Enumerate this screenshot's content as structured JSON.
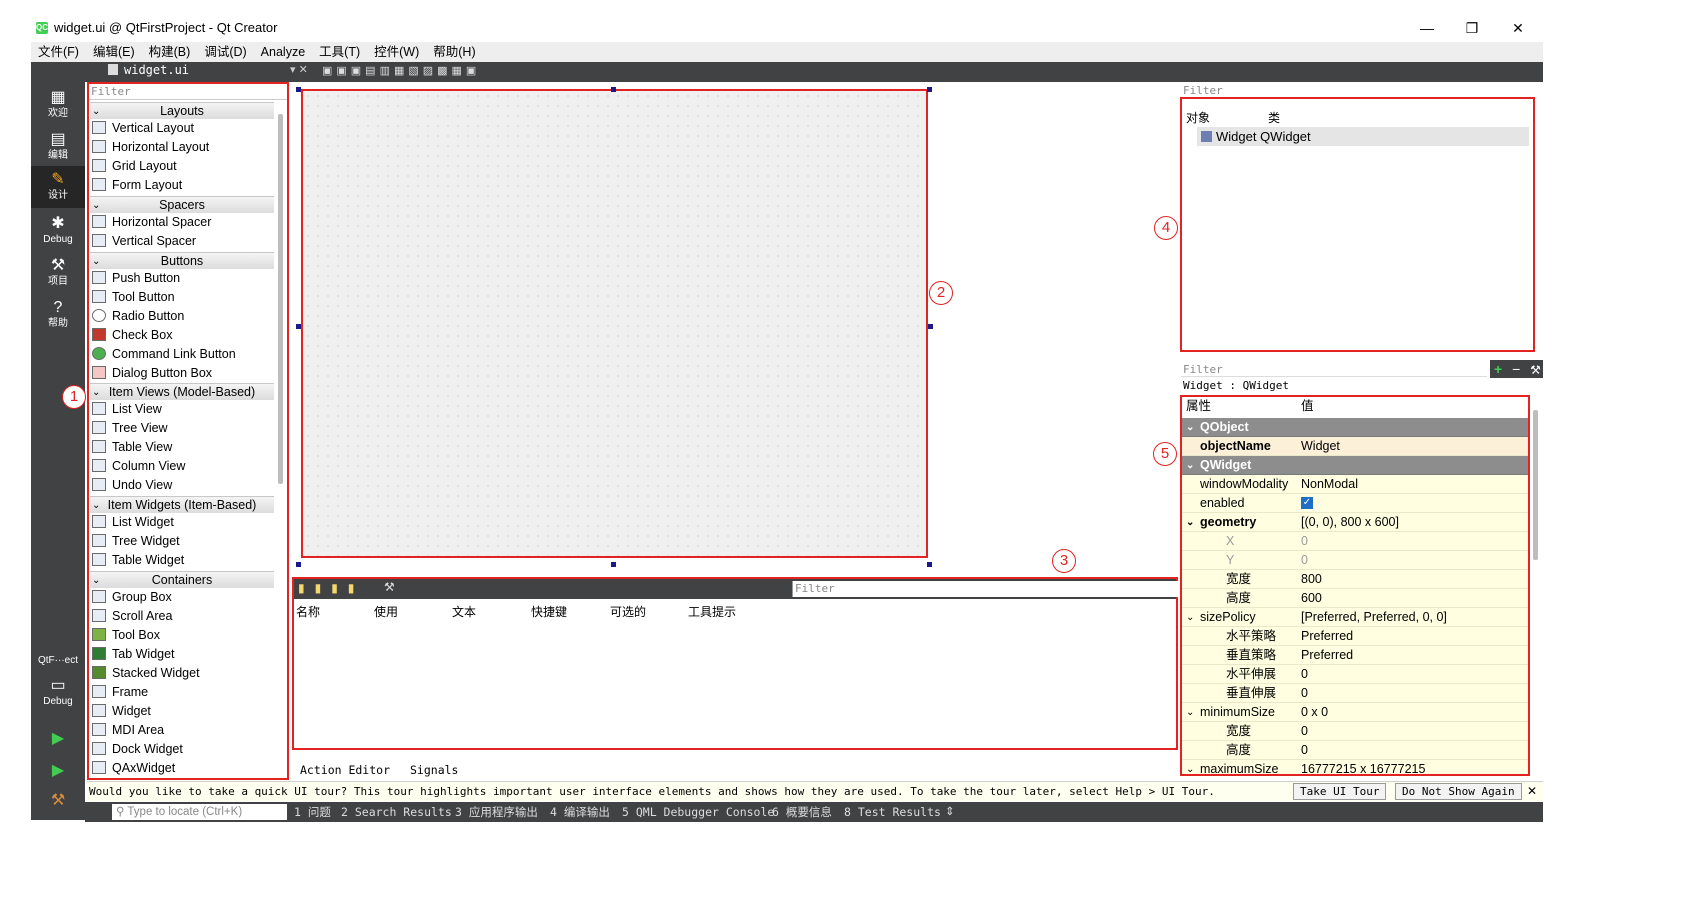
{
  "window": {
    "icon_text": "QC",
    "title": "widget.ui @ QtFirstProject - Qt Creator",
    "minimize": "—",
    "maximize": "❐",
    "close": "✕"
  },
  "menu": [
    "文件(F)",
    "编辑(E)",
    "构建(B)",
    "调试(D)",
    "Analyze",
    "工具(T)",
    "控件(W)",
    "帮助(H)"
  ],
  "modes": [
    {
      "label": "欢迎",
      "icon": "grid-icon"
    },
    {
      "label": "编辑",
      "icon": "document-icon"
    },
    {
      "label": "设计",
      "icon": "pencil-icon"
    },
    {
      "label": "Debug",
      "icon": "bug-icon"
    },
    {
      "label": "项目",
      "icon": "wrench-icon"
    },
    {
      "label": "帮助",
      "icon": "help-icon"
    }
  ],
  "kit": {
    "project": "QtF···ect",
    "config": "Debug"
  },
  "document_tab": "widget.ui",
  "widget_box": {
    "filter_placeholder": "Filter",
    "categories": {
      "layouts": "Layouts",
      "spacers": "Spacers",
      "buttons": "Buttons",
      "item_views": "Item Views (Model-Based)",
      "item_widgets": "Item Widgets (Item-Based)",
      "containers": "Containers"
    },
    "items": {
      "vertical_layout": "Vertical Layout",
      "horizontal_layout": "Horizontal Layout",
      "grid_layout": "Grid Layout",
      "form_layout": "Form Layout",
      "horizontal_spacer": "Horizontal Spacer",
      "vertical_spacer": "Vertical Spacer",
      "push_button": "Push Button",
      "tool_button": "Tool Button",
      "radio_button": "Radio Button",
      "check_box": "Check Box",
      "command_link_button": "Command Link Button",
      "dialog_button_box": "Dialog Button Box",
      "list_view": "List View",
      "tree_view": "Tree View",
      "table_view": "Table View",
      "column_view": "Column View",
      "undo_view": "Undo View",
      "list_widget": "List Widget",
      "tree_widget": "Tree Widget",
      "table_widget": "Table Widget",
      "group_box": "Group Box",
      "scroll_area": "Scroll Area",
      "tool_box": "Tool Box",
      "tab_widget": "Tab Widget",
      "stacked_widget": "Stacked Widget",
      "frame": "Frame",
      "widget": "Widget",
      "mdi_area": "MDI Area",
      "dock_widget": "Dock Widget",
      "qax_widget": "QAxWidget"
    }
  },
  "action_editor": {
    "filter_placeholder": "Filter",
    "columns": [
      "名称",
      "使用",
      "文本",
      "快捷键",
      "可选的",
      "工具提示"
    ],
    "tabs": [
      "Action Editor",
      "Signals _Slots Edi···"
    ]
  },
  "object_inspector": {
    "filter_placeholder": "Filter",
    "col_object": "对象",
    "col_class": "类",
    "row": "Widget QWidget"
  },
  "property_editor": {
    "filter_placeholder": "Filter",
    "class_line": "Widget : QWidget",
    "col_property": "属性",
    "col_value": "值",
    "rows": {
      "qobject": "QObject",
      "objectName_k": "objectName",
      "objectName_v": "Widget",
      "qwidget": "QWidget",
      "windowModality_k": "windowModality",
      "windowModality_v": "NonModal",
      "enabled_k": "enabled",
      "geometry_k": "geometry",
      "geometry_v": "[(0, 0), 800 x 600]",
      "x_k": "X",
      "x_v": "0",
      "y_k": "Y",
      "y_v": "0",
      "w_k": "宽度",
      "w_v": "800",
      "h_k": "高度",
      "h_v": "600",
      "sizePolicy_k": "sizePolicy",
      "sizePolicy_v": "[Preferred, Preferred, 0, 0]",
      "hpol_k": "水平策略",
      "hpol_v": "Preferred",
      "vpol_k": "垂直策略",
      "vpol_v": "Preferred",
      "hstr_k": "水平伸展",
      "hstr_v": "0",
      "vstr_k": "垂直伸展",
      "vstr_v": "0",
      "minimumSize_k": "minimumSize",
      "minimumSize_v": "0 x 0",
      "minw_k": "宽度",
      "minw_v": "0",
      "minh_k": "高度",
      "minh_v": "0",
      "maximumSize_k": "maximumSize",
      "maximumSize_v": "16777215 x 16777215"
    }
  },
  "callouts": [
    "1",
    "2",
    "3",
    "4",
    "5"
  ],
  "tour": {
    "text": "Would you like to take a quick UI tour? This tour highlights important user interface elements and shows how they are used. To take the tour later, select Help > UI Tour.",
    "take": "Take UI Tour",
    "dont_show": "Do Not Show Again"
  },
  "status": {
    "locate_placeholder": "Type to locate (Ctrl+K)",
    "panes": [
      "1 问题",
      "2 Search Results",
      "3 应用程序输出",
      "4 编译输出",
      "5 QML Debugger Console",
      "6 概要信息",
      "8 Test Results"
    ]
  },
  "colors": {
    "highlight_red": "#e32222",
    "dark_bar": "#404244",
    "accent_green": "#41cd52"
  }
}
